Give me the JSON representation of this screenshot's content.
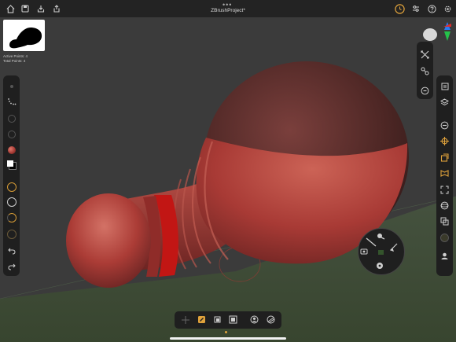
{
  "app": {
    "project_title": "ZBrushProject*"
  },
  "toolbar_top": {
    "left_icons": [
      "home-icon",
      "save-icon",
      "import-icon",
      "share-icon"
    ],
    "right_icons": [
      "timer-icon",
      "settings-sliders-icon",
      "help-icon",
      "gear-icon"
    ],
    "more_glyph": "•••"
  },
  "info": {
    "active_points": "Active Points: 4",
    "total_points": "Total Points: 4"
  },
  "left_toolbar": {
    "icons": [
      "brush-settings-icon",
      "stroke-dots-icon",
      "alpha-icon",
      "texture-icon",
      "material-icon",
      "color-swatch-icon",
      "draw-size-icon",
      "focal-shift-icon",
      "intensity-icon",
      "gravity-icon",
      "undo-icon",
      "redo-icon"
    ]
  },
  "right_toolbar_top": {
    "icons": [
      "transform-tools-icon",
      "symmetry-icon",
      "zoom-out-icon"
    ]
  },
  "right_toolbar": {
    "icons": [
      "subtools-icon",
      "layers-icon",
      "minus-icon",
      "move-icon",
      "scale-icon",
      "frame-icon",
      "focus-icon",
      "floor-icon",
      "transparency-icon",
      "polyframe-icon",
      "solo-icon"
    ]
  },
  "radial_menu": {
    "icons": [
      "brush-icon",
      "pen-icon",
      "mask-icon",
      "camera-icon",
      "visibility-icon"
    ]
  },
  "bottom_toolbar": {
    "icons": [
      "move-gizmo-icon",
      "draw-mode-icon",
      "edit-mode-icon",
      "subdivide-icon",
      "user-icon",
      "dynamesh-icon"
    ]
  },
  "colors": {
    "accent": "#e0a23b",
    "bar_bg": "#1f1f1f",
    "model_red": "#a83a35",
    "floor_green": "#3f4c3c"
  }
}
